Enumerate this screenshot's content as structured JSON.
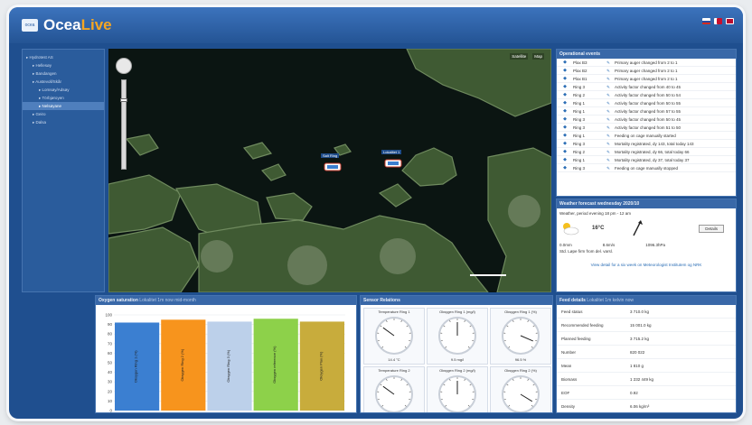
{
  "app": {
    "logo_small": "ocea",
    "brand_a": "Ocea",
    "brand_b": "Live"
  },
  "colors": {
    "frame": "#1f4f8f",
    "header": "#3968a8",
    "accent": "#f5a623",
    "link": "#2a6db5"
  },
  "sidebar": {
    "items": [
      {
        "label": "Hydrotest AS",
        "level": 0
      },
      {
        "label": "Hellesøy",
        "level": 1
      },
      {
        "label": "Bandangen",
        "level": 1
      },
      {
        "label": "Austevoll/Skår",
        "level": 1
      },
      {
        "label": "Lomsøy/Adsøy",
        "level": 2
      },
      {
        "label": "Törbjøroyen",
        "level": 2
      },
      {
        "label": "Nelsøyane",
        "level": 2,
        "selected": true
      },
      {
        "label": "Geiro",
        "level": 1
      },
      {
        "label": "Dalsa",
        "level": 1
      }
    ]
  },
  "map": {
    "toolbar": [
      "Satellite",
      "Map"
    ],
    "cages": [
      {
        "label": "Salt Ring"
      },
      {
        "label": "Lokalitet 1"
      }
    ]
  },
  "events": {
    "title": "Operational events",
    "rows": [
      {
        "cage": "Plax B3",
        "text": "Primary auger changed from 2 to 1"
      },
      {
        "cage": "Plax B2",
        "text": "Primary auger changed from 2 to 1"
      },
      {
        "cage": "Plax B1",
        "text": "Primary auger changed from 2 to 1"
      },
      {
        "cage": "Ring 3",
        "text": "Activity factor changed from 40 to 45"
      },
      {
        "cage": "Ring 2",
        "text": "Activity factor changed from 50 to 54"
      },
      {
        "cage": "Ring 1",
        "text": "Activity factor changed from 50 to 55"
      },
      {
        "cage": "Ring 1",
        "text": "Activity factor changed from 57 to 55"
      },
      {
        "cage": "Ring 3",
        "text": "Activity factor changed from 50 to 45"
      },
      {
        "cage": "Ring 3",
        "text": "Activity factor changed from 51 to 50"
      },
      {
        "cage": "Ring 1",
        "text": "Feeding on cage manually started"
      },
      {
        "cage": "Ring 3",
        "text": "Mortality registrated, dy 143, total today 143"
      },
      {
        "cage": "Ring 2",
        "text": "Mortality registrated, dy 66, total today 66"
      },
      {
        "cage": "Ring 1",
        "text": "Mortality registrated, dy 37, total today 37"
      },
      {
        "cage": "Ring 3",
        "text": "Feeding on cage manually stopped"
      }
    ]
  },
  "weather": {
    "title": "Weather forecast wednesday 2020/10",
    "period": "Weather, period evening 18 pm - 12 am",
    "temp": "16°C",
    "button": "Details",
    "rain": "0.0mm",
    "wind": "8.6m/s",
    "pressure": "1096.3hPa",
    "source": "Std. Løpe firm from del. varsl.",
    "link": "View detail for a six week on Meteorologist Institutem og NRK"
  },
  "feed": {
    "title": "Feed details",
    "subtitle": "Lokalitet 1m kelvin now",
    "rows": [
      {
        "key": "Feed status",
        "value": "3 710.0 kg"
      },
      {
        "key": "Recommended feeding",
        "value": "15 001.0 kg"
      },
      {
        "key": "Planned feeding",
        "value": "3 715.2 kg"
      },
      {
        "key": "Number",
        "value": "820 022"
      },
      {
        "key": "Mean",
        "value": "1 810 g"
      },
      {
        "key": "Biomass",
        "value": "1 232 449 kg"
      },
      {
        "key": "EOF",
        "value": "0.92"
      },
      {
        "key": "Density",
        "value": "6.06 kg/m³"
      }
    ]
  },
  "oxygen": {
    "title": "Oxygen saturation",
    "subtitle": "Lokalitet 1m now mid-month"
  },
  "chart_data": {
    "type": "bar",
    "categories": [
      "Oksygen Ring 1 (%)",
      "Oksygen Ring 2 (%)",
      "Oksygen Ring 3 (%)",
      "Oksygen reference (%)",
      "Oksygen Plax (%)"
    ],
    "values": [
      92,
      95,
      93,
      96,
      93
    ],
    "colors": [
      "#3b7fd1",
      "#f7941d",
      "#bcd0ea",
      "#8dd14a",
      "#c8ac3c"
    ],
    "ylim": [
      0,
      100
    ],
    "yticks": [
      "100",
      "90",
      "80",
      "70",
      "60",
      "50",
      "40",
      "30",
      "20",
      "10",
      "0"
    ],
    "grid": true
  },
  "sensors": {
    "title": "Sensor Relations",
    "gauges": [
      {
        "title": "Temperature Ring 1",
        "value": "14.4 °C",
        "level": 0.3
      },
      {
        "title": "Oksygen Ring 1 (mg/l)",
        "value": "9.5 mg/l",
        "level": 0.5
      },
      {
        "title": "Oksygen Ring 1 (%)",
        "value": "96.5 %",
        "level": 0.92
      },
      {
        "title": "Temperature Ring 2",
        "value": "14 °C",
        "level": 0.3
      },
      {
        "title": "Oksygen Ring 2 (mg/l)",
        "value": "9.4 mg/l",
        "level": 0.5
      },
      {
        "title": "Oksygen Ring 2 (%)",
        "value": "98.5 %",
        "level": 0.95
      }
    ]
  }
}
